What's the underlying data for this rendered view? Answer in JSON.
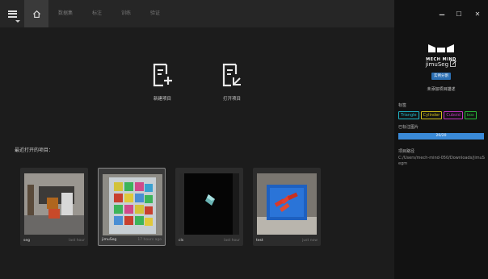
{
  "tabs": [
    {
      "label": "数据集"
    },
    {
      "label": "标注"
    },
    {
      "label": "训练"
    },
    {
      "label": "验证"
    }
  ],
  "window": {
    "minimize": "–",
    "maximize": "☐",
    "close": "✕"
  },
  "actions": {
    "new_project": "新建项目",
    "open_project": "打开项目"
  },
  "recent": {
    "title": "最近打开的项目：",
    "projects": [
      {
        "name": "seg",
        "time": "last hour"
      },
      {
        "name": "jimuSeg",
        "time": "17 hours ago"
      },
      {
        "name": "cls",
        "time": "last hour"
      },
      {
        "name": "test",
        "time": "just now"
      }
    ]
  },
  "side": {
    "brand": "MECH MIND",
    "project_name": "jimuSeg",
    "project_type": "实例分割",
    "project_desc": "未添加项目描述",
    "labels_title": "标签",
    "tags": [
      {
        "text": "Triangle",
        "color": "#1fb7c9"
      },
      {
        "text": "Cylinder",
        "color": "#d4c21a"
      },
      {
        "text": "Cuboid",
        "color": "#c435c4"
      },
      {
        "text": "box",
        "color": "#28c03a"
      }
    ],
    "annotated_title": "已标注图片",
    "progress_text": "20/20",
    "progress": 1.0,
    "path_title": "项目路径",
    "path_value": "C:/Users/mech-mind-050/Downloads/jimuSegm"
  }
}
